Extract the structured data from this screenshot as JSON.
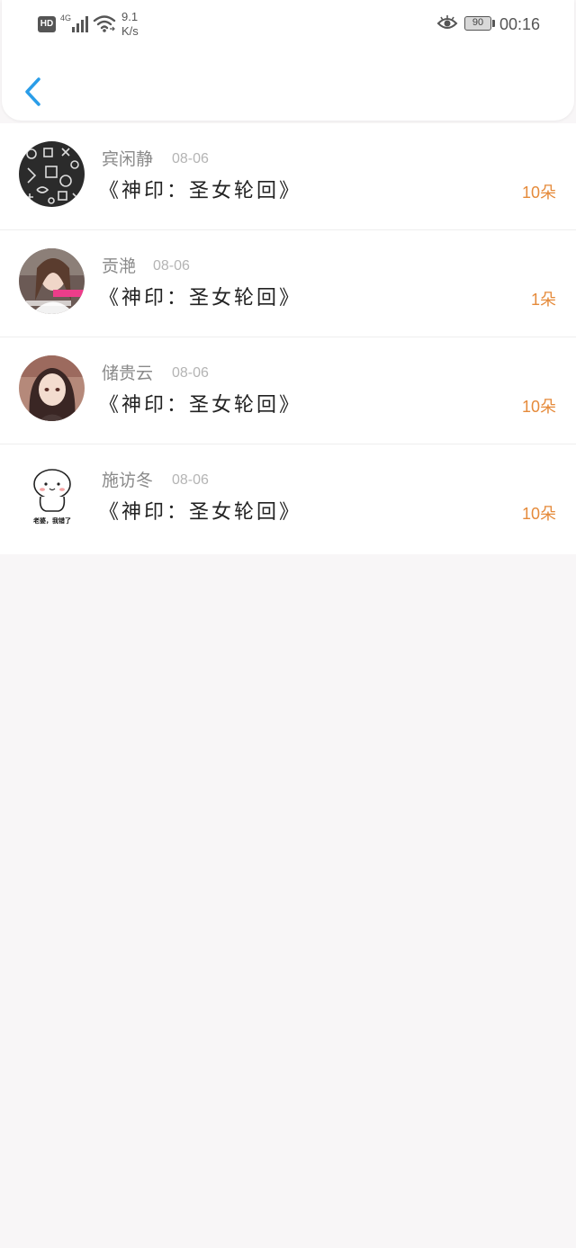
{
  "status_bar": {
    "hd": "HD",
    "network": "4G",
    "speed_value": "9.1",
    "speed_unit": "K/s",
    "battery": "90",
    "time": "00:16"
  },
  "nav": {
    "back_icon": "chevron-left-icon"
  },
  "colors": {
    "accent": "#2a9de8",
    "amount": "#e58a3a",
    "name": "#8a8a8a",
    "date": "#b4b4b4"
  },
  "records": [
    {
      "name": "宾闲静",
      "date": "08-06",
      "book": "《神印：圣女轮回》",
      "amount": "10朵",
      "avatar": "pattern-avatar"
    },
    {
      "name": "贡滟",
      "date": "08-06",
      "book": "《神印：圣女轮回》",
      "amount": "1朵",
      "avatar": "girl-photo-avatar"
    },
    {
      "name": "储贵云",
      "date": "08-06",
      "book": "《神印：圣女轮回》",
      "amount": "10朵",
      "avatar": "anime-girl-avatar"
    },
    {
      "name": "施访冬",
      "date": "08-06",
      "book": "《神印：圣女轮回》",
      "amount": "10朵",
      "avatar": "cartoon-avatar",
      "avatar_caption": "老婆，我错了"
    }
  ]
}
